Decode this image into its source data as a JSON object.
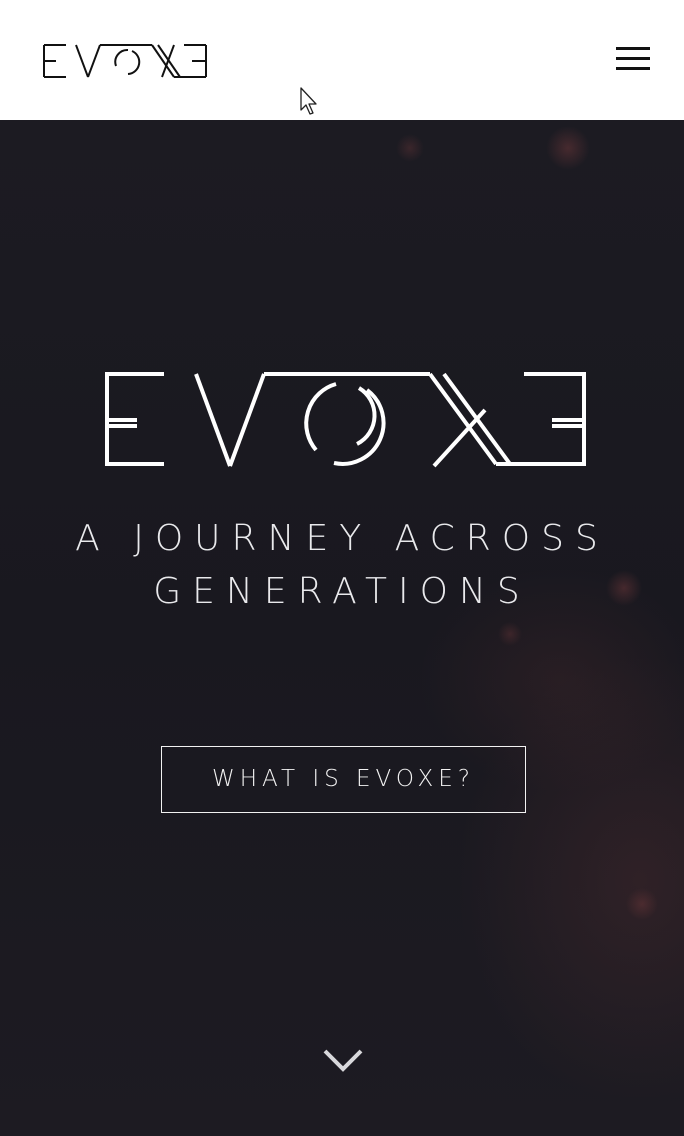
{
  "header": {
    "logo_text": "EVOXE",
    "menu_icon": "hamburger-menu-icon"
  },
  "hero": {
    "logo_text": "EVOXE",
    "tagline_line1": "A JOURNEY ACROSS",
    "tagline_line2": "GENERATIONS",
    "cta_label": "WHAT IS EVOXE?",
    "scroll_icon": "chevron-down-icon"
  },
  "colors": {
    "header_bg": "#ffffff",
    "hero_bg": "#1b1a21",
    "text_light": "#e9e9ec",
    "logo_dark": "#111111"
  }
}
